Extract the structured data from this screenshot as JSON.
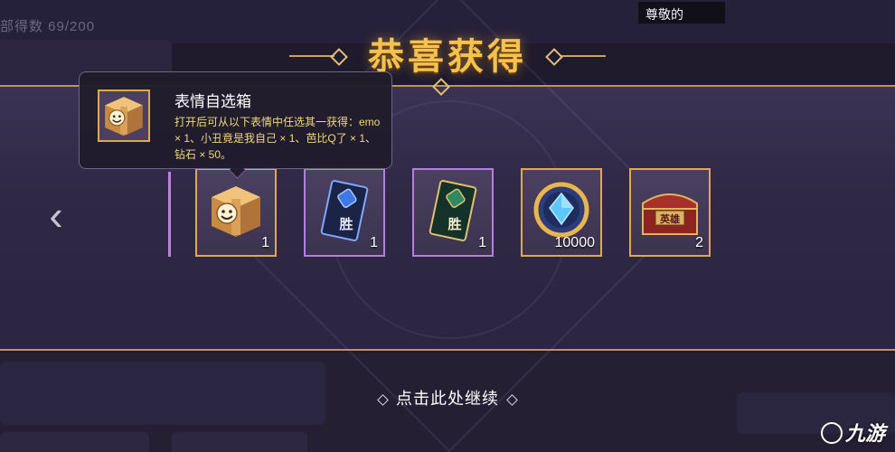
{
  "background": {
    "progress_text": "部得数 69/200",
    "username": "尊敬的"
  },
  "overlay": {
    "title": "恭喜获得",
    "continue_text": "点击此处继续",
    "nav_left_icon": "chevron-left-icon"
  },
  "tooltip": {
    "title": "表情自选箱",
    "description": "打开后可从以下表情中任选其一获得：emo × 1、小丑竟是我自己 × 1、芭比Q了 × 1、钻石 × 50。"
  },
  "rewards": [
    {
      "name": "表情自选箱",
      "icon": "emoji-box-icon",
      "count": "1",
      "rarity": "gold"
    },
    {
      "name": "胜利卡片-蓝",
      "icon": "victory-card-blue-icon",
      "label": "胜",
      "count": "1",
      "rarity": "purple"
    },
    {
      "name": "胜利卡片-绿",
      "icon": "victory-card-green-icon",
      "label": "胜",
      "count": "1",
      "rarity": "purple"
    },
    {
      "name": "钻石",
      "icon": "diamond-coin-icon",
      "count": "10000",
      "rarity": "gold"
    },
    {
      "name": "英雄宝箱",
      "icon": "hero-chest-icon",
      "label": "英雄",
      "count": "2",
      "rarity": "gold"
    }
  ],
  "watermark": "九游",
  "colors": {
    "gold": "#e0a94a",
    "purple": "#b57ee0",
    "title": "#f4c24d",
    "tooltip_desc": "#f0d97a"
  }
}
